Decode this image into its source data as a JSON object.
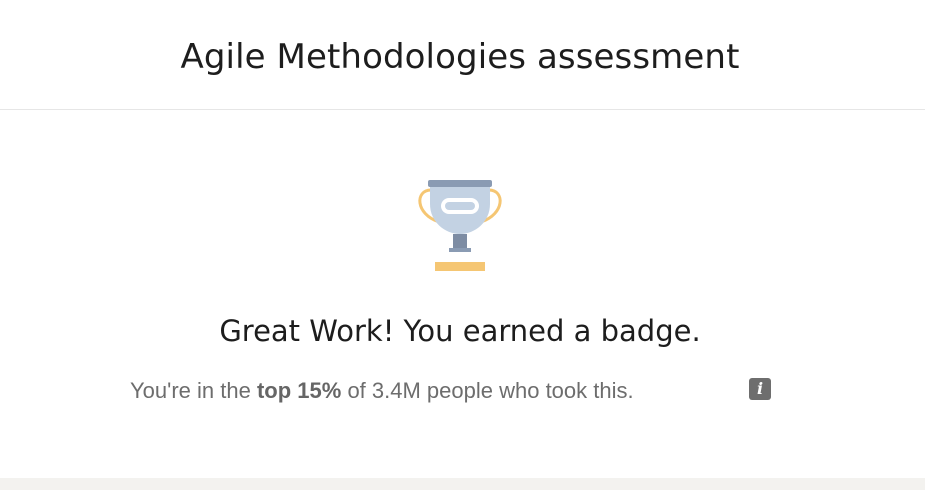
{
  "header": {
    "title": "Agile Methodologies assessment"
  },
  "result": {
    "icon": "trophy-icon",
    "headline": "Great Work! You earned a badge.",
    "stat_prefix": "You're in the",
    "stat_emphasis": "top 15%",
    "stat_suffix": "of 3.4M people who took this.",
    "info_icon": "info-icon",
    "info_glyph": "i"
  },
  "colors": {
    "trophy_cup": "#c3d2e3",
    "trophy_handles": "#f5c673",
    "trophy_rim": "#8a9bb3",
    "trophy_base": "#f5c673",
    "text_primary": "#1d1d1d",
    "text_secondary": "#6d6d6d",
    "footer_band": "#f3f2ef"
  }
}
